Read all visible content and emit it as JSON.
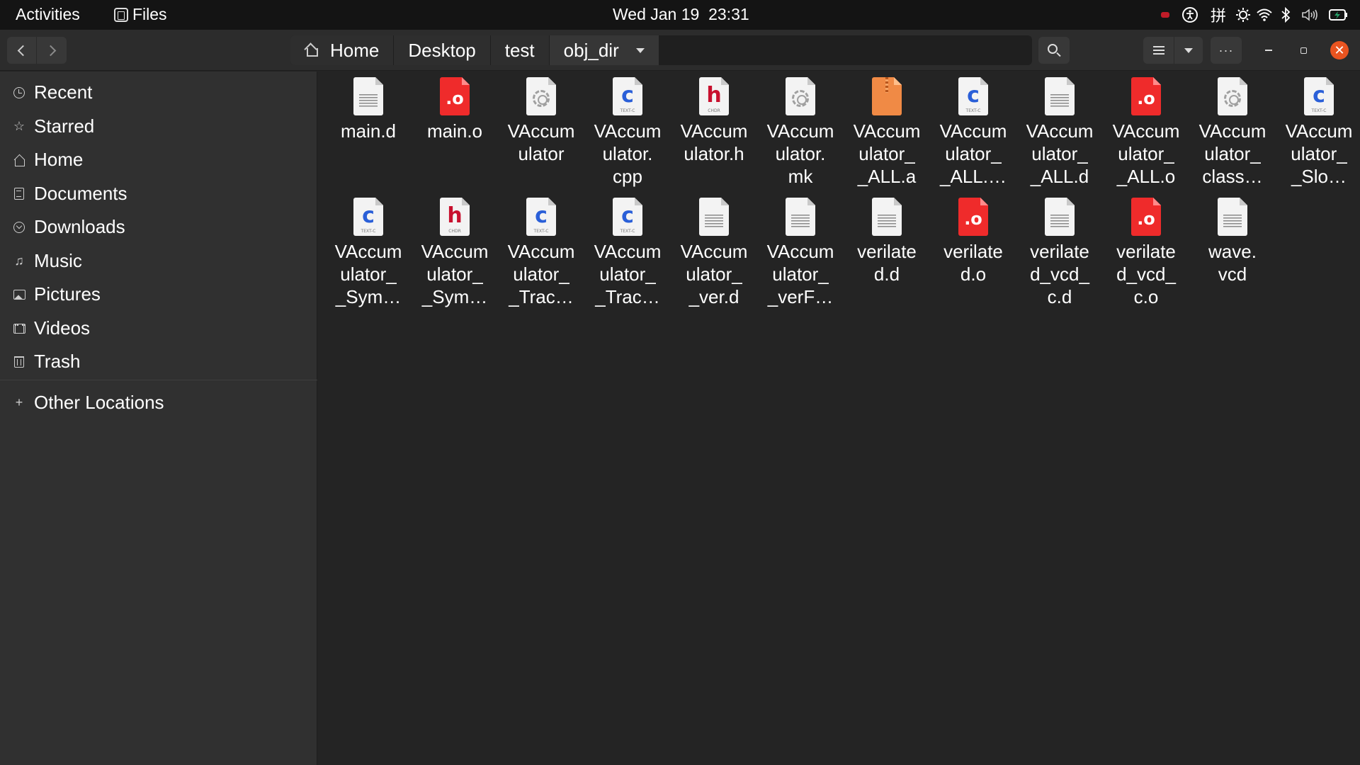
{
  "topbar": {
    "activities": "Activities",
    "app_name": "Files",
    "clock": "Wed Jan 19  23:31",
    "tray_icons": [
      "recording-indicator",
      "accessibility-icon",
      "input-method-icon",
      "brightness-icon",
      "wifi-icon",
      "bluetooth-icon",
      "volume-icon",
      "battery-icon"
    ],
    "input_method_label": "拼"
  },
  "pathbar": {
    "crumbs": [
      "Home",
      "Desktop",
      "test",
      "obj_dir"
    ]
  },
  "header": {
    "menu_label": "···"
  },
  "sidebar": {
    "items": [
      {
        "label": "Recent",
        "icon": "clock-icon"
      },
      {
        "label": "Starred",
        "icon": "star-icon"
      },
      {
        "label": "Home",
        "icon": "home-icon"
      },
      {
        "label": "Documents",
        "icon": "documents-icon"
      },
      {
        "label": "Downloads",
        "icon": "downloads-icon"
      },
      {
        "label": "Music",
        "icon": "music-icon"
      },
      {
        "label": "Pictures",
        "icon": "pictures-icon"
      },
      {
        "label": "Videos",
        "icon": "videos-icon"
      },
      {
        "label": "Trash",
        "icon": "trash-icon"
      }
    ],
    "other_locations": "Other Locations"
  },
  "files": [
    {
      "name": "main.d",
      "type": "text"
    },
    {
      "name": "main.o",
      "type": "object"
    },
    {
      "name": "VAccum\nulator",
      "type": "executable"
    },
    {
      "name": "VAccum\nulator.\ncpp",
      "type": "c-source"
    },
    {
      "name": "VAccum\nulator.h",
      "type": "c-header"
    },
    {
      "name": "VAccum\nulator.\nmk",
      "type": "executable"
    },
    {
      "name": "VAccum\nulator_\n_ALL.a",
      "type": "archive"
    },
    {
      "name": "VAccum\nulator_\n_ALL.…",
      "type": "c-source"
    },
    {
      "name": "VAccum\nulator_\n_ALL.d",
      "type": "text"
    },
    {
      "name": "VAccum\nulator_\n_ALL.o",
      "type": "object"
    },
    {
      "name": "VAccum\nulator_\nclass…",
      "type": "executable"
    },
    {
      "name": "VAccum\nulator_\n_Slo…",
      "type": "c-source"
    },
    {
      "name": "VAccum\nulator_\n_Sym…",
      "type": "c-source"
    },
    {
      "name": "VAccum\nulator_\n_Sym…",
      "type": "c-header"
    },
    {
      "name": "VAccum\nulator_\n_Trac…",
      "type": "c-source"
    },
    {
      "name": "VAccum\nulator_\n_Trac…",
      "type": "c-source"
    },
    {
      "name": "VAccum\nulator_\n_ver.d",
      "type": "text"
    },
    {
      "name": "VAccum\nulator_\n_verF…",
      "type": "text"
    },
    {
      "name": "verilate\nd.d",
      "type": "text"
    },
    {
      "name": "verilate\nd.o",
      "type": "object"
    },
    {
      "name": "verilate\nd_vcd_\nc.d",
      "type": "text"
    },
    {
      "name": "verilate\nd_vcd_\nc.o",
      "type": "object"
    },
    {
      "name": "wave.\nvcd",
      "type": "text"
    }
  ],
  "icon_labels": {
    "c_letter": "c",
    "c_sub": "TEXT-C",
    "h_letter": "h",
    "h_sub": "CHDR",
    "o_letter": ".o"
  },
  "colors": {
    "accent": "#e95420",
    "object_red": "#ef2b2b",
    "c_blue": "#2a5fd8",
    "h_red": "#c8102e",
    "archive_orange": "#f08a45"
  }
}
